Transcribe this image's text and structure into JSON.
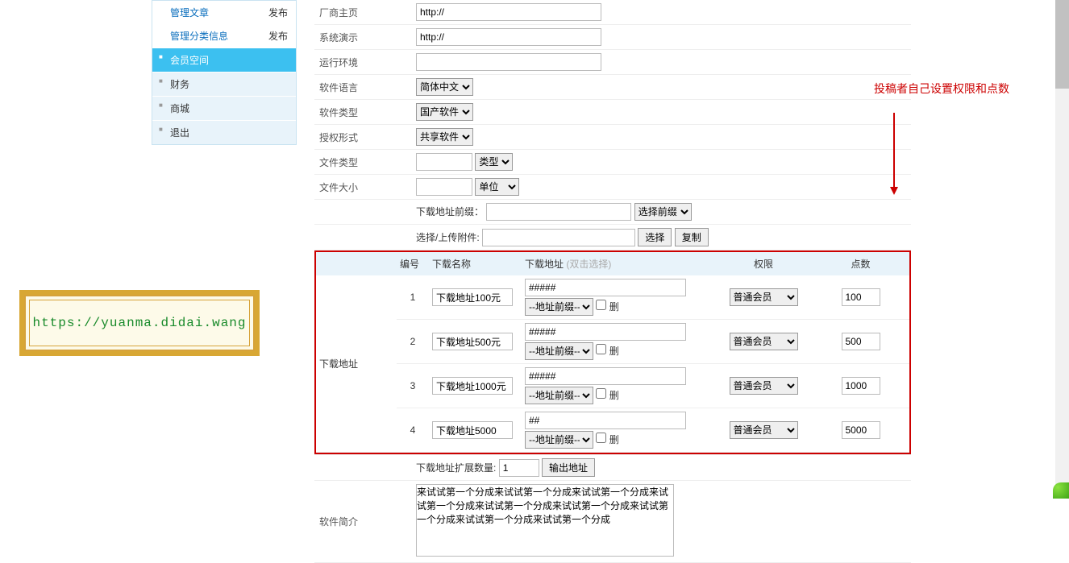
{
  "sidebar": {
    "text_rows": [
      {
        "label": "管理文章",
        "action": "发布"
      },
      {
        "label": "管理分类信息",
        "action": "发布"
      }
    ],
    "items": [
      {
        "label": "会员空间",
        "active": true
      },
      {
        "label": "财务",
        "active": false
      },
      {
        "label": "商城",
        "active": false
      },
      {
        "label": "退出",
        "active": false
      }
    ]
  },
  "form": {
    "homepage_label": "厂商主页",
    "homepage_value": "http://",
    "demo_label": "系统演示",
    "demo_value": "http://",
    "env_label": "运行环境",
    "env_value": "",
    "lang_label": "软件语言",
    "lang_value": "简体中文",
    "type_label": "软件类型",
    "type_value": "国产软件",
    "license_label": "授权形式",
    "license_value": "共享软件",
    "filetype_label": "文件类型",
    "filetype_value": "",
    "filetype_select": "类型",
    "filesize_label": "文件大小",
    "filesize_value": "",
    "filesize_select": "单位",
    "prefix_label": "下载地址前缀：",
    "prefix_value": "",
    "prefix_select": "选择前缀",
    "upload_label": "选择/上传附件:",
    "upload_value": "",
    "upload_btn_select": "选择",
    "upload_btn_copy": "复制",
    "dl_section_label": "下载地址",
    "ext_count_label": "下载地址扩展数量:",
    "ext_count_value": "1",
    "ext_btn": "输出地址",
    "intro_label": "软件简介",
    "intro_value": "来试试第一个分成来试试第一个分成来试试第一个分成来试试第一个分成来试试第一个分成来试试第一个分成来试试第一个分成来试试第一个分成来试试第一个分成"
  },
  "dl_table": {
    "headers": {
      "no": "编号",
      "name": "下载名称",
      "addr": "下载地址",
      "addr_hint": "(双击选择)",
      "perm": "权限",
      "points": "点数"
    },
    "prefix_select": "--地址前缀--",
    "del_label": "删",
    "rows": [
      {
        "no": "1",
        "name": "下载地址100元",
        "addr": "#####",
        "perm": "普通会员",
        "points": "100"
      },
      {
        "no": "2",
        "name": "下载地址500元",
        "addr": "#####",
        "perm": "普通会员",
        "points": "500"
      },
      {
        "no": "3",
        "name": "下载地址1000元",
        "addr": "#####",
        "perm": "普通会员",
        "points": "1000"
      },
      {
        "no": "4",
        "name": "下载地址5000",
        "addr": "##",
        "perm": "普通会员",
        "points": "5000"
      }
    ]
  },
  "annotation": "投稿者自己设置权限和点数",
  "watermark": "https://yuanma.didai.wang"
}
